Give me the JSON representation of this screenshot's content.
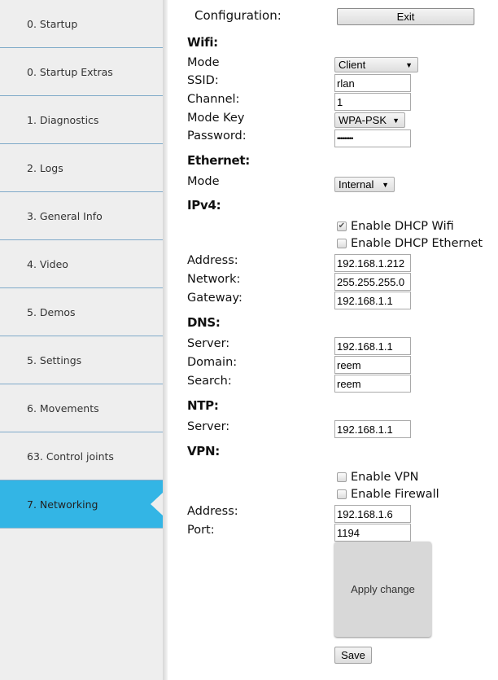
{
  "sidebar": {
    "items": [
      {
        "label": "0. Startup",
        "active": false
      },
      {
        "label": "0. Startup Extras",
        "active": false
      },
      {
        "label": "1. Diagnostics",
        "active": false
      },
      {
        "label": "2. Logs",
        "active": false
      },
      {
        "label": "3. General Info",
        "active": false
      },
      {
        "label": "4. Video",
        "active": false
      },
      {
        "label": "5. Demos",
        "active": false
      },
      {
        "label": "5. Settings",
        "active": false
      },
      {
        "label": "6. Movements",
        "active": false
      },
      {
        "label": "63. Control joints",
        "active": false
      },
      {
        "label": "7. Networking",
        "active": true
      }
    ],
    "active_color": "#33b5e5"
  },
  "config": {
    "title": "Configuration:",
    "exit_label": "Exit"
  },
  "wifi": {
    "header": "Wifi:",
    "mode_label": "Mode",
    "mode_value": "Client",
    "ssid_label": "SSID:",
    "ssid_value": "rlan",
    "channel_label": "Channel:",
    "channel_value": "1",
    "mode_key_label": "Mode Key",
    "mode_key_value": "WPA-PSK",
    "password_label": "Password:",
    "password_value": "•••••••••"
  },
  "ethernet": {
    "header": "Ethernet:",
    "mode_label": "Mode",
    "mode_value": "Internal"
  },
  "ipv4": {
    "header": "IPv4:",
    "dhcp_wifi_label": "Enable DHCP Wifi",
    "dhcp_wifi_checked": true,
    "dhcp_ethernet_label": "Enable DHCP Ethernet",
    "dhcp_ethernet_checked": false,
    "address_label": "Address:",
    "address_value": "192.168.1.212",
    "network_label": "Network:",
    "network_value": "255.255.255.0",
    "gateway_label": "Gateway:",
    "gateway_value": "192.168.1.1"
  },
  "dns": {
    "header": "DNS:",
    "server_label": "Server:",
    "server_value": "192.168.1.1",
    "domain_label": "Domain:",
    "domain_value": "reem",
    "search_label": "Search:",
    "search_value": "reem"
  },
  "ntp": {
    "header": "NTP:",
    "server_label": "Server:",
    "server_value": "192.168.1.1"
  },
  "vpn": {
    "header": "VPN:",
    "enable_vpn_label": "Enable VPN",
    "enable_vpn_checked": false,
    "enable_firewall_label": "Enable Firewall",
    "enable_firewall_checked": false,
    "address_label": "Address:",
    "address_value": "192.168.1.6",
    "port_label": "Port:",
    "port_value": "1194"
  },
  "actions": {
    "apply_label": "Apply change",
    "save_label": "Save"
  },
  "icons": {
    "caret": "▼",
    "check": "✔"
  }
}
